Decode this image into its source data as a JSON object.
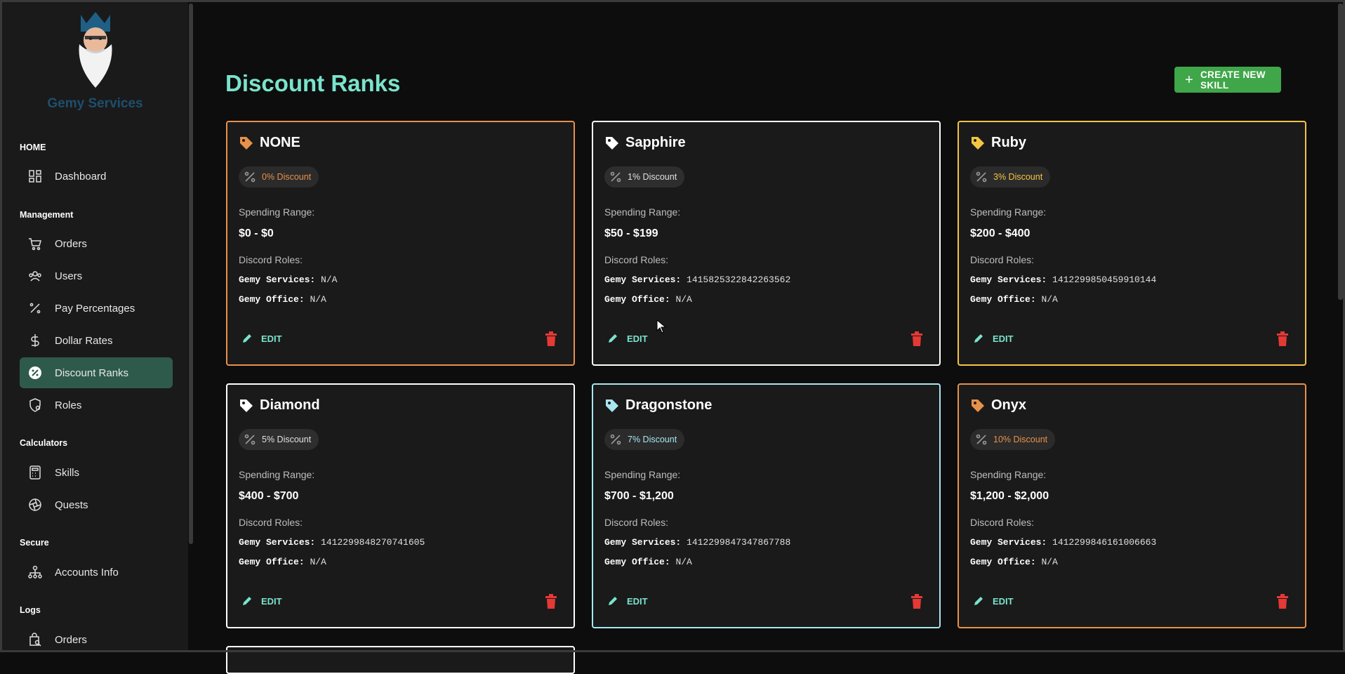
{
  "sidebar": {
    "brand": "Gemy Services",
    "sections": {
      "home": "HOME",
      "management": "Management",
      "calculators": "Calculators",
      "secure": "Secure",
      "logs": "Logs"
    },
    "items": {
      "dashboard": "Dashboard",
      "orders": "Orders",
      "users": "Users",
      "pay_percentages": "Pay Percentages",
      "dollar_rates": "Dollar Rates",
      "discount_ranks": "Discount Ranks",
      "roles": "Roles",
      "skills": "Skills",
      "quests": "Quests",
      "accounts_info": "Accounts Info",
      "logs_orders": "Orders"
    }
  },
  "page": {
    "title": "Discount Ranks",
    "create_button": "CREATE NEW SKILL"
  },
  "labels": {
    "spending_range": "Spending Range:",
    "discord_roles": "Discord Roles:",
    "gemy_services": "Gemy Services:",
    "gemy_office": "Gemy Office:",
    "edit": "EDIT"
  },
  "ranks": [
    {
      "name": "NONE",
      "discount": "0% Discount",
      "range": "$0 - $0",
      "gemy_services": "N/A",
      "gemy_office": "N/A",
      "color": "#e8914a"
    },
    {
      "name": "Sapphire",
      "discount": "1% Discount",
      "range": "$50 - $199",
      "gemy_services": "1415825322842263562",
      "gemy_office": "N/A",
      "color": "#ffffff"
    },
    {
      "name": "Ruby",
      "discount": "3% Discount",
      "range": "$200 - $400",
      "gemy_services": "1412299850459910144",
      "gemy_office": "N/A",
      "color": "#f5c542"
    },
    {
      "name": "Diamond",
      "discount": "5% Discount",
      "range": "$400 - $700",
      "gemy_services": "1412299848270741605",
      "gemy_office": "N/A",
      "color": "#ffffff"
    },
    {
      "name": "Dragonstone",
      "discount": "7% Discount",
      "range": "$700 - $1,200",
      "gemy_services": "1412299847347867788",
      "gemy_office": "N/A",
      "color": "#a8e6f0"
    },
    {
      "name": "Onyx",
      "discount": "10% Discount",
      "range": "$1,200 - $2,000",
      "gemy_services": "1412299846161006663",
      "gemy_office": "N/A",
      "color": "#e8914a"
    }
  ]
}
